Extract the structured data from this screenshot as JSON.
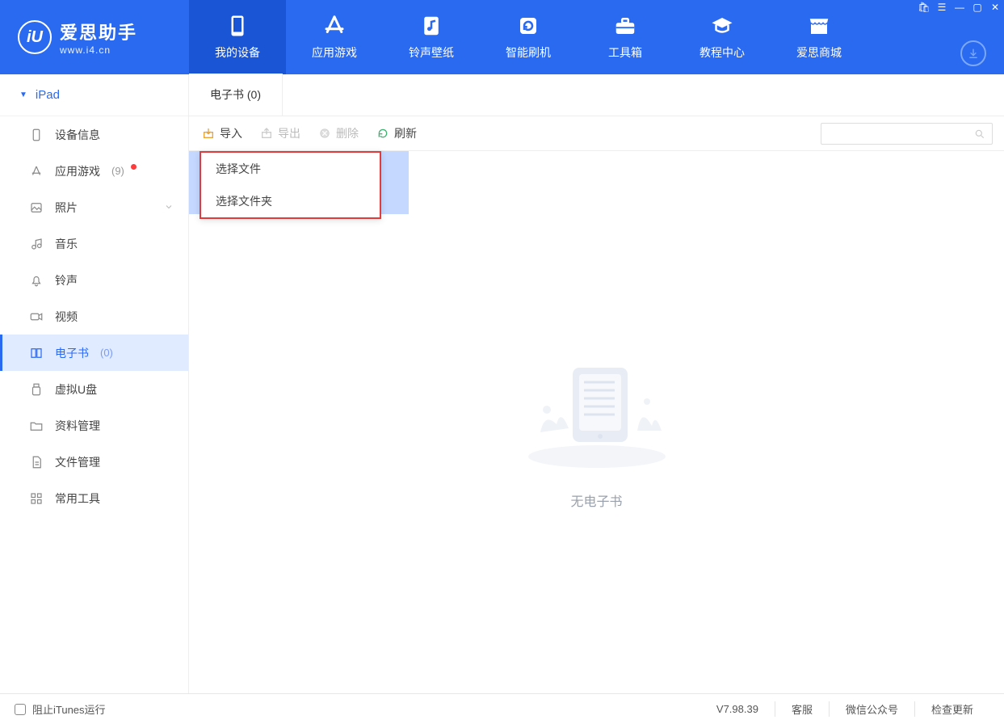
{
  "colors": {
    "primary": "#2a6af1",
    "primary_dark": "#1a55d6",
    "highlight_border": "#e23b3b"
  },
  "app": {
    "title": "爱思助手",
    "url": "www.i4.cn",
    "logo_letters": "iU"
  },
  "window_controls": {
    "shop": "🛍",
    "list": "☰",
    "min": "—",
    "max": "▢",
    "close": "✕"
  },
  "nav": [
    {
      "key": "device",
      "label": "我的设备",
      "active": true
    },
    {
      "key": "apps",
      "label": "应用游戏",
      "active": false
    },
    {
      "key": "ringwall",
      "label": "铃声壁纸",
      "active": false
    },
    {
      "key": "flash",
      "label": "智能刷机",
      "active": false
    },
    {
      "key": "toolbox",
      "label": "工具箱",
      "active": false
    },
    {
      "key": "tutorial",
      "label": "教程中心",
      "active": false
    },
    {
      "key": "mall",
      "label": "爱思商城",
      "active": false
    }
  ],
  "sidebar": {
    "device_label": "iPad",
    "items": [
      {
        "key": "info",
        "label": "设备信息"
      },
      {
        "key": "apps",
        "label": "应用游戏",
        "count": "(9)",
        "badge": true
      },
      {
        "key": "photos",
        "label": "照片",
        "chevron": true
      },
      {
        "key": "music",
        "label": "音乐"
      },
      {
        "key": "ring",
        "label": "铃声"
      },
      {
        "key": "video",
        "label": "视频"
      },
      {
        "key": "ebook",
        "label": "电子书",
        "count": "(0)",
        "active": true
      },
      {
        "key": "udisk",
        "label": "虚拟U盘"
      },
      {
        "key": "data",
        "label": "资料管理"
      },
      {
        "key": "files",
        "label": "文件管理"
      },
      {
        "key": "tools",
        "label": "常用工具"
      }
    ]
  },
  "main": {
    "tab_label": "电子书 (0)",
    "toolbar": {
      "import": "导入",
      "export": "导出",
      "delete": "删除",
      "refresh": "刷新"
    },
    "dropdown": {
      "select_file": "选择文件",
      "select_folder": "选择文件夹"
    },
    "empty_text": "无电子书",
    "search_placeholder": ""
  },
  "status": {
    "block_itunes": "阻止iTunes运行",
    "version": "V7.98.39",
    "support": "客服",
    "wechat": "微信公众号",
    "update": "检查更新"
  }
}
